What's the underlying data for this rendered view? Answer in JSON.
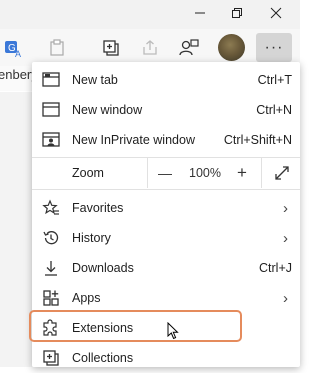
{
  "browser": {
    "bookmarks_text": "enbery",
    "more_label": "···"
  },
  "menu": {
    "items": [
      {
        "label": "New tab",
        "shortcut": "Ctrl+T",
        "icon": "new-tab-icon"
      },
      {
        "label": "New window",
        "shortcut": "Ctrl+N",
        "icon": "new-window-icon"
      },
      {
        "label": "New InPrivate window",
        "shortcut": "Ctrl+Shift+N",
        "icon": "inprivate-icon"
      }
    ],
    "zoom": {
      "label": "Zoom",
      "minus": "—",
      "value": "100%",
      "plus": "+",
      "fullscreen_icon": "fullscreen-icon"
    },
    "items2": [
      {
        "label": "Favorites",
        "icon": "favorites-icon",
        "has_submenu": true
      },
      {
        "label": "History",
        "icon": "history-icon",
        "has_submenu": true
      },
      {
        "label": "Downloads",
        "shortcut": "Ctrl+J",
        "icon": "download-icon"
      },
      {
        "label": "Apps",
        "icon": "apps-icon",
        "has_submenu": true
      },
      {
        "label": "Extensions",
        "icon": "extensions-icon"
      },
      {
        "label": "Collections",
        "icon": "collections-icon"
      }
    ],
    "chevron": "›"
  },
  "colors": {
    "highlight": "#e58b5c",
    "menu_bg": "#ffffff",
    "more_button_bg": "#d5d5d5"
  }
}
